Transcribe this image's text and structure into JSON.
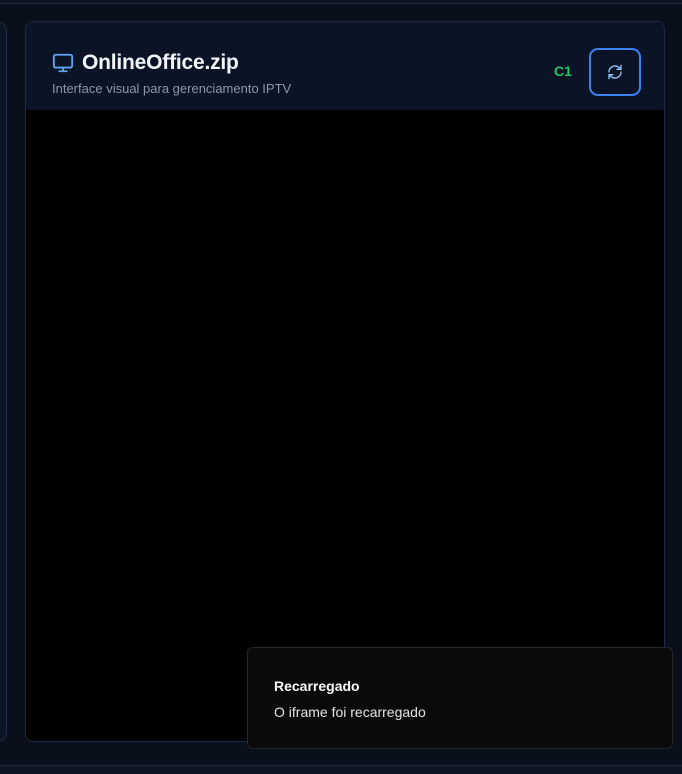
{
  "card": {
    "title": "OnlineOffice.zip",
    "subtitle": "Interface visual para gerenciamento IPTV",
    "tag": "C1",
    "title_icon": "monitor-icon",
    "reload_icon": "refresh-icon"
  },
  "toast": {
    "title": "Recarregado",
    "description": "O iframe foi recarregado"
  },
  "colors": {
    "accent": "#3b82f6",
    "tag": "#22c55e",
    "background": "#0a0f1c"
  }
}
